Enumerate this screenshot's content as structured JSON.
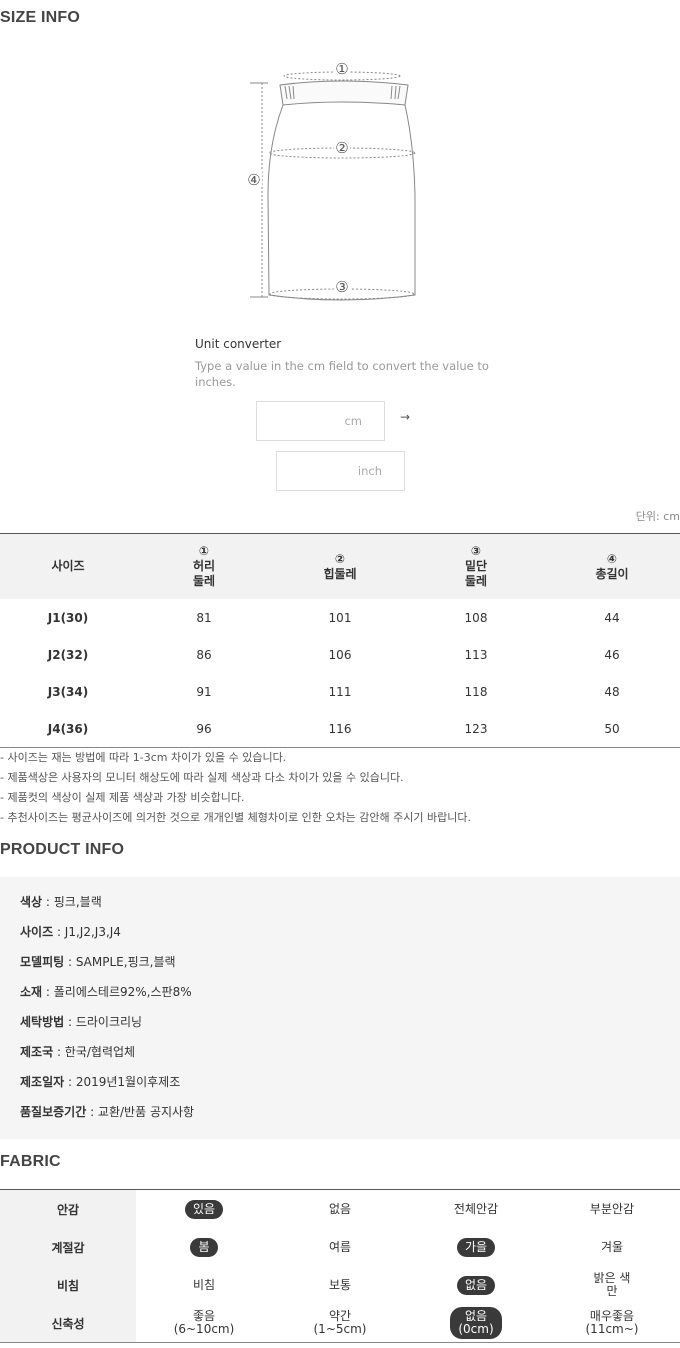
{
  "size_info": {
    "title": "SIZE INFO",
    "markers": [
      "①",
      "②",
      "③",
      "④"
    ],
    "converter": {
      "title": "Unit converter",
      "description": "Type a value in the cm field to convert the value to inches.",
      "cm_unit": "cm",
      "inch_unit": "inch",
      "arrow": "→"
    },
    "unit_note": "단위: cm",
    "table": {
      "headers": [
        {
          "line1": "사이즈",
          "line2": "",
          "line3": ""
        },
        {
          "line1": "①",
          "line2": "허리",
          "line3": "둘레"
        },
        {
          "line1": "②",
          "line2": "힙둘레",
          "line3": ""
        },
        {
          "line1": "③",
          "line2": "밑단",
          "line3": "둘레"
        },
        {
          "line1": "④",
          "line2": "총길이",
          "line3": ""
        }
      ],
      "rows": [
        [
          "J1(30)",
          "81",
          "101",
          "108",
          "44"
        ],
        [
          "J2(32)",
          "86",
          "106",
          "113",
          "46"
        ],
        [
          "J3(34)",
          "91",
          "111",
          "118",
          "48"
        ],
        [
          "J4(36)",
          "96",
          "116",
          "123",
          "50"
        ]
      ]
    },
    "notes": [
      "- 사이즈는 재는 방법에 따라 1-3cm 차이가 있을 수 있습니다.",
      "- 제품색상은 사용자의 모니터 해상도에 따라 실제 색상과 다소 차이가 있을 수 있습니다.",
      "- 제품컷의 색상이 실제 제품 색상과 가장 비슷합니다.",
      "- 추천사이즈는 평균사이즈에 의거한 것으로 개개인별 체형차이로 인한 오차는 감안해 주시기 바랍니다."
    ]
  },
  "product_info": {
    "title": "PRODUCT INFO",
    "rows": [
      {
        "key": "색상",
        "value": " : 핑크,블랙"
      },
      {
        "key": "사이즈",
        "value": " : J1,J2,J3,J4"
      },
      {
        "key": "모델피팅",
        "value": " : SAMPLE,핑크,블랙"
      },
      {
        "key": "소재",
        "value": " : 폴리에스테르92%,스판8%"
      },
      {
        "key": "세탁방법",
        "value": " : 드라이크리닝"
      },
      {
        "key": "제조국",
        "value": " : 한국/협력업체"
      },
      {
        "key": "제조일자",
        "value": " : 2019년1월이후제조"
      },
      {
        "key": "품질보증기간",
        "value": " : 교환/반품 공지사항"
      }
    ]
  },
  "fabric": {
    "title": "FABRIC",
    "rows": [
      {
        "label": "안감",
        "options": [
          {
            "line1": "있음",
            "line2": "",
            "selected": true
          },
          {
            "line1": "없음",
            "line2": "",
            "selected": false
          },
          {
            "line1": "전체안감",
            "line2": "",
            "selected": false
          },
          {
            "line1": "부분안감",
            "line2": "",
            "selected": false
          }
        ]
      },
      {
        "label": "계절감",
        "options": [
          {
            "line1": "봄",
            "line2": "",
            "selected": true
          },
          {
            "line1": "여름",
            "line2": "",
            "selected": false
          },
          {
            "line1": "가을",
            "line2": "",
            "selected": true
          },
          {
            "line1": "겨울",
            "line2": "",
            "selected": false
          }
        ]
      },
      {
        "label": "비침",
        "options": [
          {
            "line1": "비침",
            "line2": "",
            "selected": false
          },
          {
            "line1": "보통",
            "line2": "",
            "selected": false
          },
          {
            "line1": "없음",
            "line2": "",
            "selected": true
          },
          {
            "line1": "밝은 색",
            "line2": "만",
            "selected": false
          }
        ]
      },
      {
        "label": "신축성",
        "options": [
          {
            "line1": "좋음",
            "line2": "(6~10cm)",
            "selected": false
          },
          {
            "line1": "약간",
            "line2": "(1~5cm)",
            "selected": false
          },
          {
            "line1": "없음",
            "line2": "(0cm)",
            "selected": true
          },
          {
            "line1": "매우좋음",
            "line2": "(11cm~)",
            "selected": false
          }
        ]
      }
    ]
  },
  "colors": {
    "selected_badge": "#3a3a3a",
    "header_bg": "#f2f2f2",
    "info_bg": "#f5f5f5"
  }
}
